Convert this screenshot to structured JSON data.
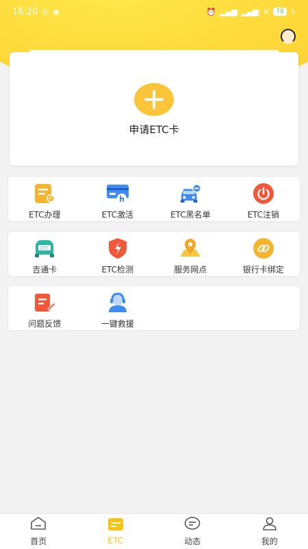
{
  "status_bar": {
    "time": "16:20",
    "battery": "78"
  },
  "apply": {
    "label": "申请ETC卡"
  },
  "grids": [
    {
      "items": [
        {
          "label": "ETC办理",
          "icon": "document-edit-icon",
          "color": "#f5b430"
        },
        {
          "label": "ETC激活",
          "icon": "card-touch-icon",
          "color": "#3f8bf1"
        },
        {
          "label": "ETC黑名单",
          "icon": "car-minus-icon",
          "color": "#3f8bf1"
        },
        {
          "label": "ETC注销",
          "icon": "power-icon",
          "color": "#f2573a"
        }
      ]
    },
    {
      "items": [
        {
          "label": "吉通卡",
          "icon": "etc-car-icon",
          "color": "#2fb5a5"
        },
        {
          "label": "ETC检测",
          "icon": "shield-bolt-icon",
          "color": "#f2573a"
        },
        {
          "label": "服务网点",
          "icon": "map-pin-icon",
          "color": "#f5b430"
        },
        {
          "label": "银行卡绑定",
          "icon": "link-icon",
          "color": "#f5b430"
        }
      ]
    },
    {
      "items": [
        {
          "label": "问题反馈",
          "icon": "feedback-doc-icon",
          "color": "#f2573a"
        },
        {
          "label": "一键救援",
          "icon": "headset-agent-icon",
          "color": "#3f8bf1"
        }
      ]
    }
  ],
  "tabs": [
    {
      "label": "首页",
      "icon": "home-icon"
    },
    {
      "label": "ETC",
      "icon": "etc-card-icon",
      "active": true
    },
    {
      "label": "动态",
      "icon": "message-icon"
    },
    {
      "label": "我的",
      "icon": "user-icon"
    }
  ],
  "colors": {
    "accent": "#fbd12f",
    "active_tab": "#f9c316"
  }
}
